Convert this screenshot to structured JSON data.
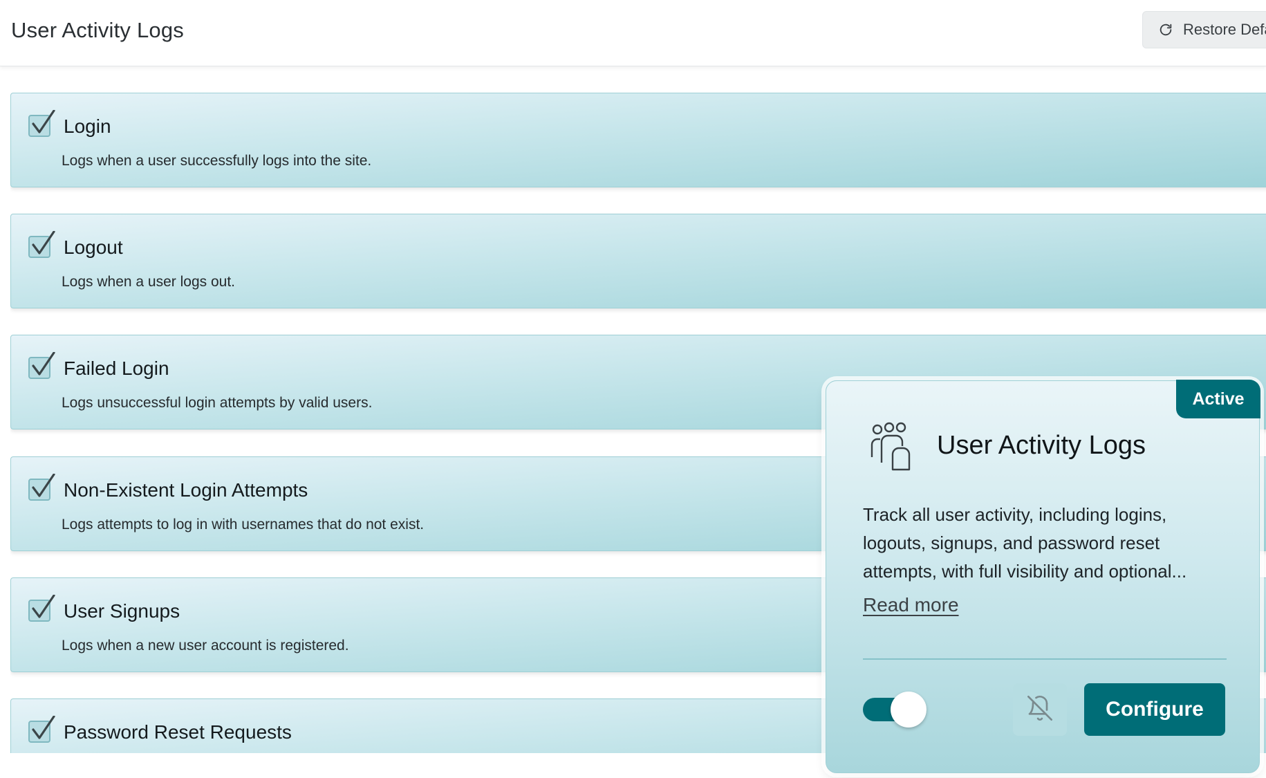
{
  "header": {
    "title": "User Activity Logs",
    "restore_label": "Restore Defa"
  },
  "events": [
    {
      "title": "Login",
      "description": "Logs when a user successfully logs into the site.",
      "checked": true
    },
    {
      "title": "Logout",
      "description": "Logs when a user logs out.",
      "checked": true
    },
    {
      "title": "Failed Login",
      "description": "Logs unsuccessful login attempts by valid users.",
      "checked": true
    },
    {
      "title": "Non-Existent Login Attempts",
      "description": "Logs attempts to log in with usernames that do not exist.",
      "checked": true
    },
    {
      "title": "User Signups",
      "description": "Logs when a new user account is registered.",
      "checked": true
    },
    {
      "title": "Password Reset Requests",
      "description": "",
      "checked": true
    }
  ],
  "card": {
    "badge": "Active",
    "title": "User Activity Logs",
    "description": "Track all user activity, including logins, logouts, signups, and password reset attempts, with full visibility and optional...",
    "read_more": "Read more",
    "enabled": true,
    "notifications": "off",
    "configure_label": "Configure"
  },
  "colors": {
    "accent": "#006d77",
    "row_gradient_start": "#e6f3f8",
    "row_gradient_end": "#9fd3d9"
  }
}
